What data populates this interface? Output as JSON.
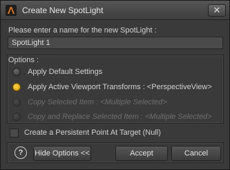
{
  "window": {
    "title": "Create New SpotLight",
    "close_symbol": "✕"
  },
  "name_section": {
    "label": "Please enter a name for the new SpotLight :",
    "value": "SpotLight 1"
  },
  "options": {
    "legend": "Options :",
    "items": [
      {
        "label": "Apply Default Settings",
        "selected": false,
        "enabled": true
      },
      {
        "label": "Apply Active Viewport Transforms : <PerspectiveView>",
        "selected": true,
        "enabled": true
      },
      {
        "label": "Copy Selected Item : <Multiple Selected>",
        "selected": false,
        "enabled": false
      },
      {
        "label": "Copy and Replace Selected Item : <Multiple Selected>",
        "selected": false,
        "enabled": false
      }
    ]
  },
  "persistent_point": {
    "label": "Create a Persistent Point At Target (Null)",
    "checked": false
  },
  "footer": {
    "help_symbol": "?",
    "hide_options_label": "Hide Options <<",
    "accept_label": "Accept",
    "cancel_label": "Cancel"
  },
  "icons": {
    "app_logo": "daz-studio-logo-icon",
    "close": "close-icon",
    "help": "help-icon"
  },
  "colors": {
    "accent_radio": "#f2b81c",
    "background": "#3a3a3a",
    "disabled_text": "#6e6e6e"
  }
}
